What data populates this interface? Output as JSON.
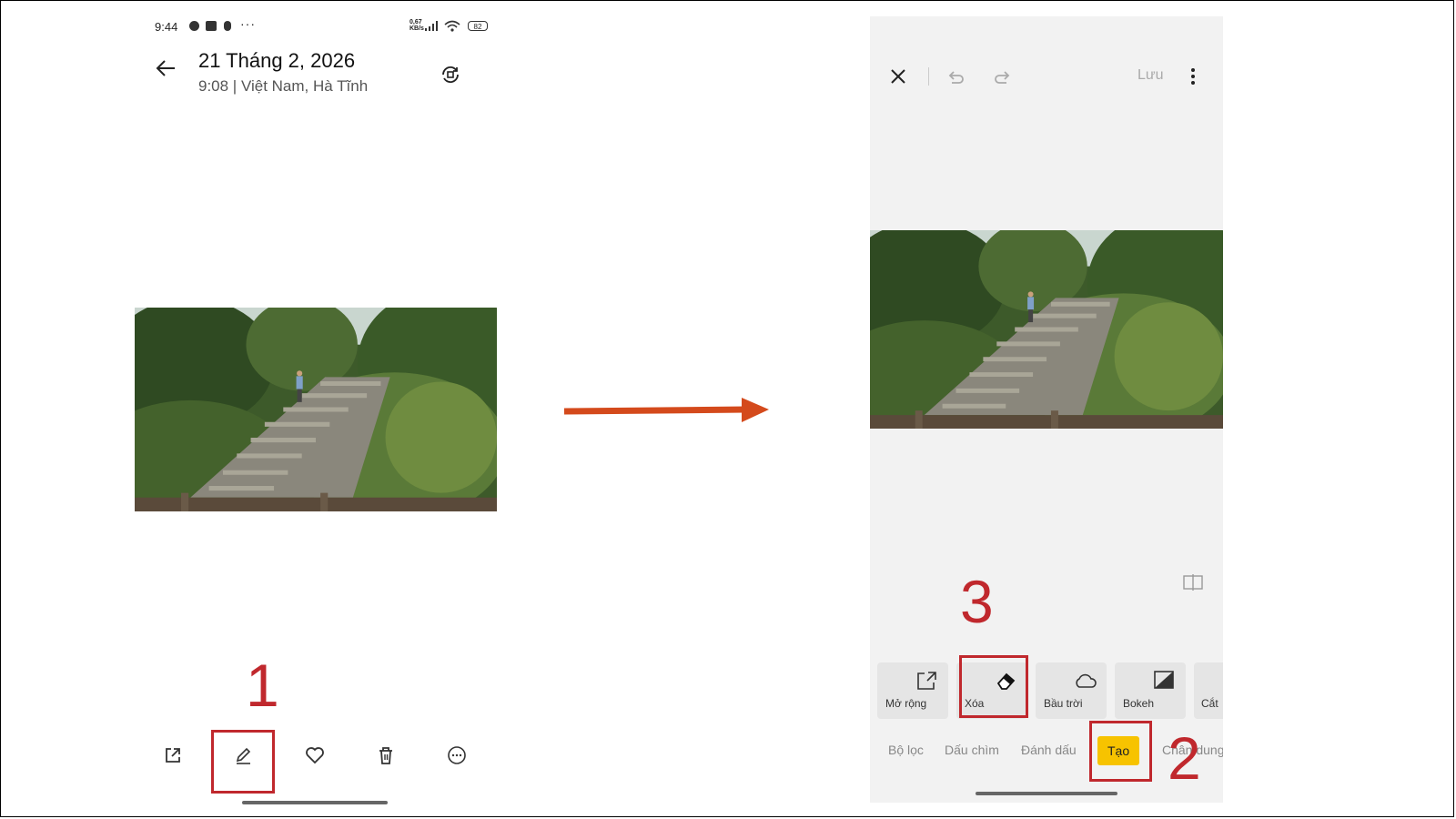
{
  "left_screen": {
    "status": {
      "time": "9:44",
      "speed": "0,67\nKB/s",
      "battery": "82"
    },
    "header": {
      "title": "21 Tháng 2, 2026",
      "subtitle": "9:08 | Việt Nam, Hà Tĩnh"
    },
    "toolbar": [
      "share-icon",
      "edit-icon",
      "heart-icon",
      "trash-icon",
      "more-icon"
    ]
  },
  "right_screen": {
    "top_bar": {
      "save_label": "Lưu"
    },
    "tools": [
      {
        "label": "Mở rộng",
        "icon": "expand-icon"
      },
      {
        "label": "Xóa",
        "icon": "eraser-icon"
      },
      {
        "label": "Bầu trời",
        "icon": "cloud-icon"
      },
      {
        "label": "Bokeh",
        "icon": "bokeh-icon"
      },
      {
        "label": "Cắt",
        "icon": "cut-icon"
      }
    ],
    "tabs": [
      {
        "label": "Bộ lọc"
      },
      {
        "label": "Dấu chìm"
      },
      {
        "label": "Đánh dấu"
      },
      {
        "label": "Tạo",
        "active": true
      },
      {
        "label": "Chân dung"
      }
    ]
  },
  "annotations": {
    "step1": "1",
    "step2": "2",
    "step3": "3"
  },
  "colors": {
    "callout": "#c0282d",
    "arrow": "#d44a1c",
    "active_tab": "#f7c300"
  }
}
